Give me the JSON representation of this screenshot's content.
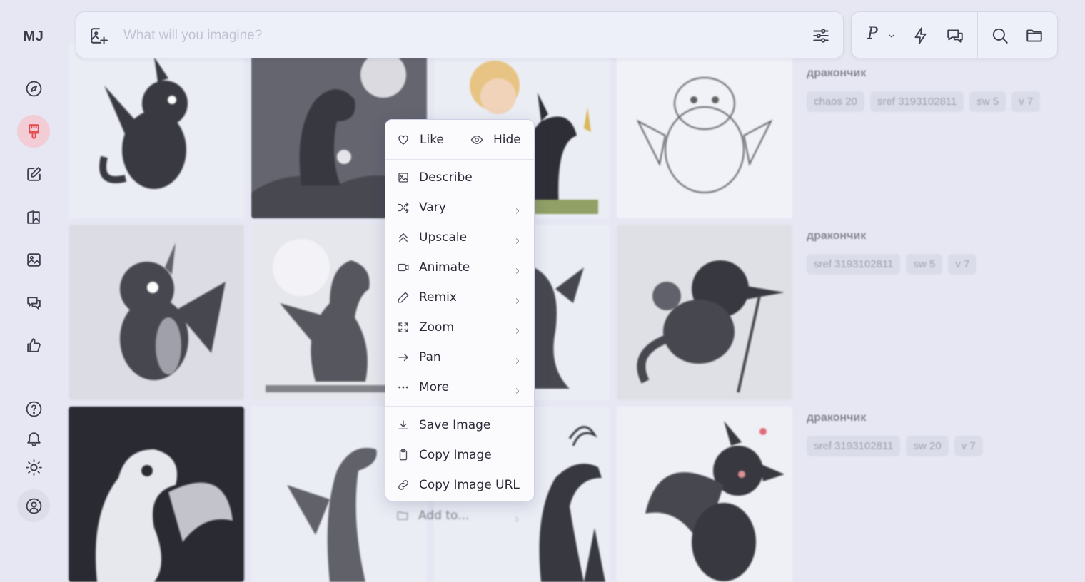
{
  "sidebar": {
    "logo": "MJ"
  },
  "search": {
    "placeholder": "What will you imagine?"
  },
  "toolbar": {
    "personalize_label": "P"
  },
  "info_rows": [
    {
      "title": "дракончик",
      "chips": [
        "chaos 20",
        "sref 3193102811",
        "sw 5",
        "v 7"
      ]
    },
    {
      "title": "дракончик",
      "chips": [
        "sref 3193102811",
        "sw 5",
        "v 7"
      ]
    },
    {
      "title": "дракончик",
      "chips": [
        "sref 3193102811",
        "sw 20",
        "v 7"
      ]
    }
  ],
  "context_menu": {
    "like": "Like",
    "hide": "Hide",
    "describe": "Describe",
    "vary": "Vary",
    "upscale": "Upscale",
    "animate": "Animate",
    "remix": "Remix",
    "zoom": "Zoom",
    "pan": "Pan",
    "more": "More",
    "save_image": "Save Image",
    "copy_image": "Copy Image",
    "copy_image_url": "Copy Image URL",
    "add_to": "Add to..."
  }
}
